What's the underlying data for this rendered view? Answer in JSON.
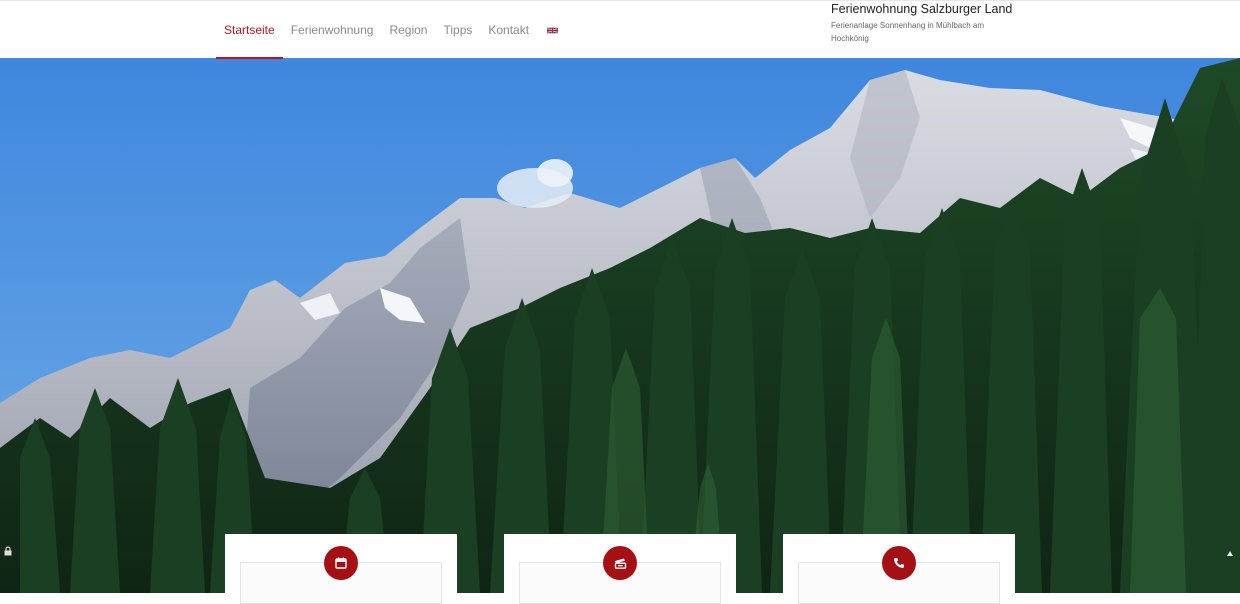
{
  "nav": {
    "items": [
      {
        "label": "Startseite",
        "active": true
      },
      {
        "label": "Ferienwohnung",
        "active": false
      },
      {
        "label": "Region",
        "active": false
      },
      {
        "label": "Tipps",
        "active": false
      },
      {
        "label": "Kontakt",
        "active": false
      }
    ],
    "language_flag": "uk-flag-icon"
  },
  "brand": {
    "title": "Ferienwohnung Salzburger Land",
    "subtitle": "Ferienanlage Sonnenhang in Mühlbach am Hochkönig"
  },
  "hero": {
    "image_subject": "mountain-forest-photo"
  },
  "cards": [
    {
      "icon": "calendar-icon"
    },
    {
      "icon": "ticket-icon"
    },
    {
      "icon": "phone-icon"
    }
  ],
  "colors": {
    "accent": "#b4181b",
    "icon_circle": "#a51014",
    "nav_text": "#8a8a8a",
    "sky": "#4b8edb"
  }
}
